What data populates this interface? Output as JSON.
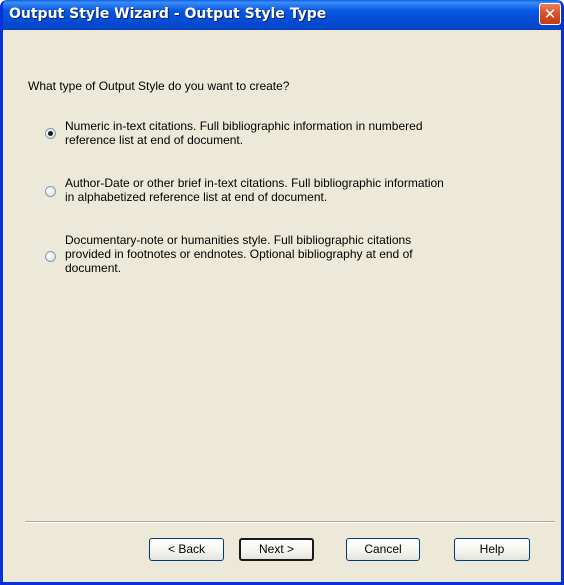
{
  "window": {
    "title": "Output Style Wizard - Output Style Type",
    "close_glyph": "✕"
  },
  "main": {
    "question": "What type of Output Style do you want to create?",
    "options": [
      {
        "label": "Numeric in-text citations. Full bibliographic information in numbered\nreference list at end of document.",
        "selected": true
      },
      {
        "label": "Author-Date or other brief in-text citations. Full bibliographic information\nin alphabetized reference list at end of document.",
        "selected": false
      },
      {
        "label": "Documentary-note or humanities style. Full bibliographic citations\nprovided in footnotes or endnotes. Optional bibliography at end of\ndocument.",
        "selected": false
      }
    ]
  },
  "footer": {
    "back_label": "< Back",
    "next_label": "Next >",
    "cancel_label": "Cancel",
    "help_label": "Help"
  },
  "colors": {
    "titlebar": "#0450d8",
    "dialog_bg": "#ece9d8",
    "close_button": "#d9522c"
  },
  "icons": {
    "close": "close-icon"
  }
}
